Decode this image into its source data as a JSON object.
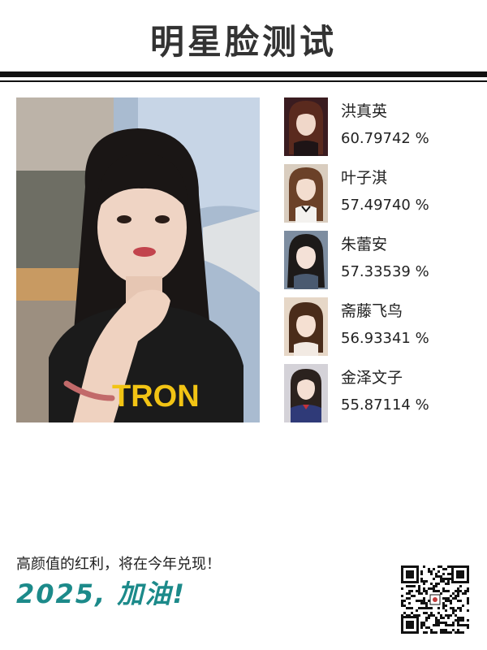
{
  "header": {
    "title": "明星脸测试"
  },
  "photo": {
    "shirt_text": "TRON"
  },
  "matches": [
    {
      "name": "洪真英",
      "score": "60.79742 %",
      "hair": "#5a2a1e",
      "bg": "#3a1c20"
    },
    {
      "name": "叶子淇",
      "score": "57.49740 %",
      "hair": "#6b4128",
      "bg": "#c9b8a4"
    },
    {
      "name": "朱蕾安",
      "score": "57.33539 %",
      "hair": "#1d1a19",
      "bg": "#7d8da0"
    },
    {
      "name": "斋藤飞鸟",
      "score": "56.93341 %",
      "hair": "#4a2c1a",
      "bg": "#e6d7c7"
    },
    {
      "name": "金泽文子",
      "score": "55.87114 %",
      "hair": "#2b221e",
      "bg": "#d4d2d8"
    }
  ],
  "footer": {
    "tagline": "高颜值的红利，将在今年兑现！",
    "slogan": "2025, 加油!"
  },
  "colors": {
    "accent": "#1c8a8a",
    "rule": "#111111"
  }
}
